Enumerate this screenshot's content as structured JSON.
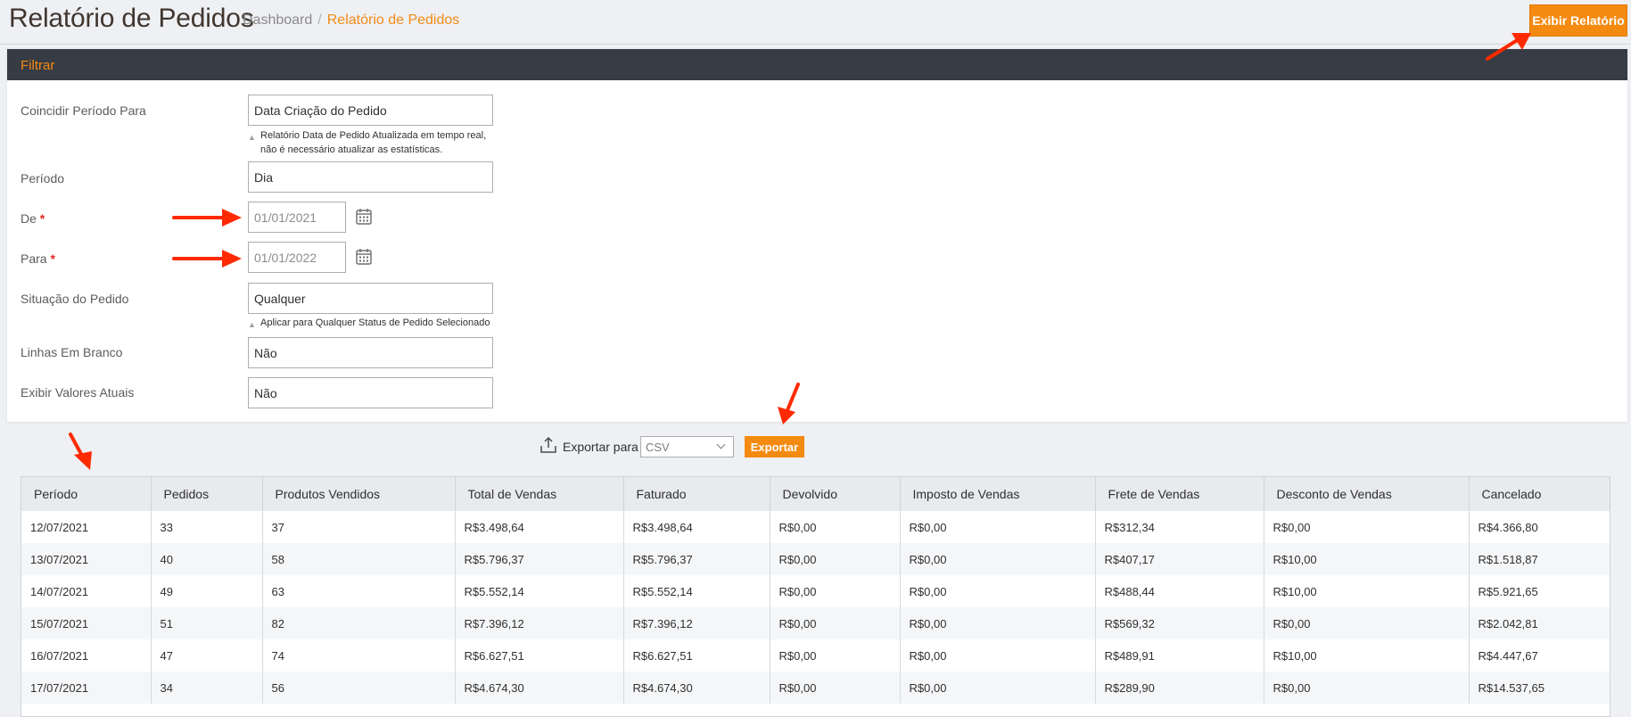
{
  "header": {
    "title": "Relatório de Pedidos",
    "breadcrumb_home": "Dashboard",
    "breadcrumb_sep": "/",
    "breadcrumb_current": "Relatório de Pedidos",
    "show_report_label": "Exibir Relatório"
  },
  "filter": {
    "title": "Filtrar",
    "match_period": {
      "label": "Coincidir Período Para",
      "value": "Data Criação do Pedido",
      "note": "Relatório Data de Pedido Atualizada em tempo real, não é necessário atualizar as estatísticas."
    },
    "period": {
      "label": "Período",
      "value": "Dia"
    },
    "from": {
      "label": "De",
      "required": "*",
      "value": "01/01/2021"
    },
    "to": {
      "label": "Para",
      "required": "*",
      "value": "01/01/2022"
    },
    "order_status": {
      "label": "Situação do Pedido",
      "value": "Qualquer",
      "note": "Aplicar para Qualquer Status de Pedido Selecionado"
    },
    "empty_rows": {
      "label": "Linhas Em Branco",
      "value": "Não"
    },
    "actual_values": {
      "label": "Exibir Valores Atuais",
      "value": "Não"
    }
  },
  "export": {
    "label": "Exportar para :",
    "format": "CSV",
    "button": "Exportar"
  },
  "table": {
    "columns": [
      "Período",
      "Pedidos",
      "Produtos Vendidos",
      "Total de Vendas",
      "Faturado",
      "Devolvido",
      "Imposto de Vendas",
      "Frete de Vendas",
      "Desconto de Vendas",
      "Cancelado"
    ],
    "rows": [
      [
        "12/07/2021",
        "33",
        "37",
        "R$3.498,64",
        "R$3.498,64",
        "R$0,00",
        "R$0,00",
        "R$312,34",
        "R$0,00",
        "R$4.366,80"
      ],
      [
        "13/07/2021",
        "40",
        "58",
        "R$5.796,37",
        "R$5.796,37",
        "R$0,00",
        "R$0,00",
        "R$407,17",
        "R$10,00",
        "R$1.518,87"
      ],
      [
        "14/07/2021",
        "49",
        "63",
        "R$5.552,14",
        "R$5.552,14",
        "R$0,00",
        "R$0,00",
        "R$488,44",
        "R$10,00",
        "R$5.921,65"
      ],
      [
        "15/07/2021",
        "51",
        "82",
        "R$7.396,12",
        "R$7.396,12",
        "R$0,00",
        "R$0,00",
        "R$569,32",
        "R$0,00",
        "R$2.042,81"
      ],
      [
        "16/07/2021",
        "47",
        "74",
        "R$6.627,51",
        "R$6.627,51",
        "R$0,00",
        "R$0,00",
        "R$489,91",
        "R$10,00",
        "R$4.447,67"
      ],
      [
        "17/07/2021",
        "34",
        "56",
        "R$4.674,30",
        "R$4.674,30",
        "R$0,00",
        "R$0,00",
        "R$289,90",
        "R$0,00",
        "R$14.537,65"
      ]
    ]
  },
  "colors": {
    "accent": "#f58a10",
    "panel_header": "#373c44",
    "annotation_arrow": "#ff2a00"
  }
}
